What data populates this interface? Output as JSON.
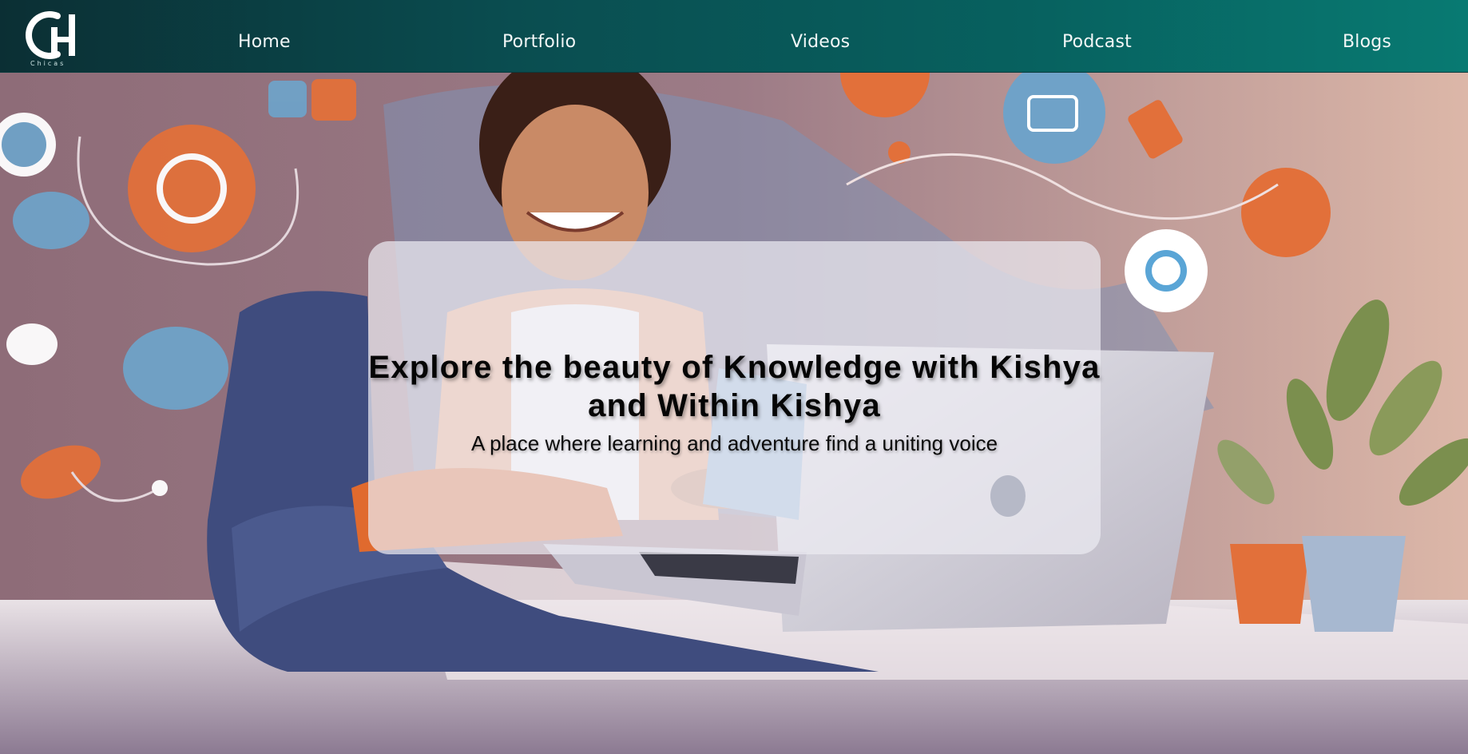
{
  "brand": {
    "logo_letters": "CH",
    "logo_caption": "Chicas"
  },
  "nav": {
    "items": [
      {
        "label": "Home"
      },
      {
        "label": "Portfolio"
      },
      {
        "label": "Videos"
      },
      {
        "label": "Podcast"
      },
      {
        "label": "Blogs"
      }
    ]
  },
  "hero": {
    "title": "Explore the beauty of Knowledge with Kishya and Within Kishya",
    "subtitle": "A place where learning and adventure find a uniting voice",
    "image_description_icon": "illustration"
  },
  "colors": {
    "nav_start": "#0b2f34",
    "nav_end": "#087a72",
    "accent_orange": "#e2703a",
    "accent_blue": "#5d8fb8"
  }
}
